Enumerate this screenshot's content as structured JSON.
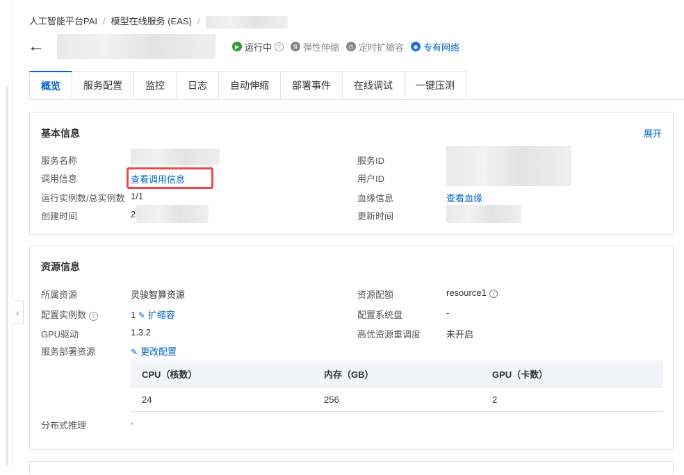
{
  "breadcrumb": {
    "items": [
      "人工智能平台PAI",
      "模型在线服务 (EAS)"
    ],
    "separator": "/"
  },
  "header": {
    "back_icon": "arrow-left-icon",
    "statuses": [
      {
        "label": "运行中",
        "icon": "play-circle-icon",
        "color": "#2ca32c"
      },
      {
        "label": "弹性伸缩",
        "icon": "scale-icon"
      },
      {
        "label": "定时扩缩容",
        "icon": "clock-icon"
      },
      {
        "label": "专有网络",
        "icon": "network-icon"
      }
    ]
  },
  "tabs": [
    "概览",
    "服务配置",
    "监控",
    "日志",
    "自动伸缩",
    "部署事件",
    "在线调试",
    "一键压测"
  ],
  "basic_info": {
    "title": "基本信息",
    "expand_label": "展开",
    "left": [
      {
        "label": "服务名称",
        "value": ""
      },
      {
        "label": "调用信息",
        "value": "查看调用信息"
      },
      {
        "label": "运行实例数/总实例数",
        "value": "1/1"
      },
      {
        "label": "创建时间",
        "value": "2"
      }
    ],
    "right": [
      {
        "label": "服务ID",
        "value": ""
      },
      {
        "label": "用户ID",
        "value": ""
      },
      {
        "label": "血缘信息",
        "value": "查看血缘"
      },
      {
        "label": "更新时间",
        "value": ""
      }
    ]
  },
  "resource_info": {
    "title": "资源信息",
    "left": [
      {
        "label": "所属资源",
        "value": "灵骏智算资源"
      },
      {
        "label": "配置实例数",
        "value": "1",
        "action": "扩缩容"
      },
      {
        "label": "GPU驱动",
        "value": "1.3.2"
      },
      {
        "label": "服务部署资源",
        "action": "更改配置"
      }
    ],
    "right": [
      {
        "label": "资源配额",
        "value": "resource1"
      },
      {
        "label": "配置系统盘",
        "value": "-"
      },
      {
        "label": "高优资源重调度",
        "value": "未开启"
      }
    ],
    "table": {
      "headers": [
        "CPU（核数）",
        "内存（GB）",
        "GPU（卡数）"
      ],
      "rows": [
        [
          "24",
          "256",
          "2"
        ]
      ]
    },
    "distributed": {
      "label": "分布式推理",
      "value": "-"
    }
  },
  "colors": {
    "accent": "#0064c8",
    "highlight": "#f0474a",
    "running": "#2ca32c"
  }
}
